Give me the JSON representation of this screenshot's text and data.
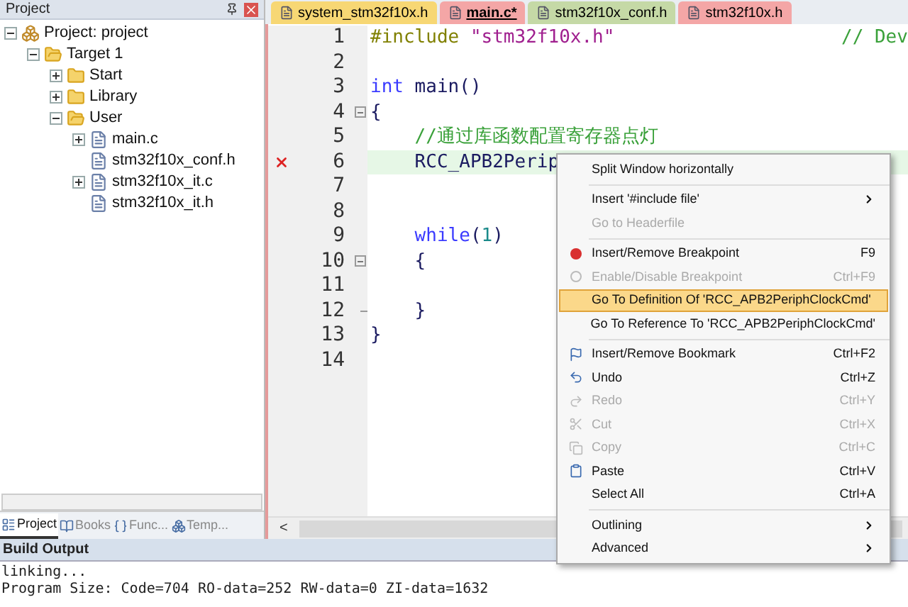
{
  "project_panel": {
    "title": "Project",
    "tree": [
      {
        "label": "Project: project",
        "kind": "project",
        "expanded": true,
        "children": [
          {
            "label": "Target 1",
            "kind": "target",
            "expanded": true,
            "children": [
              {
                "label": "Start",
                "kind": "folder",
                "expanded": false
              },
              {
                "label": "Library",
                "kind": "folder",
                "expanded": false
              },
              {
                "label": "User",
                "kind": "folder",
                "expanded": true,
                "children": [
                  {
                    "label": "main.c",
                    "kind": "file",
                    "expanded": false
                  },
                  {
                    "label": "stm32f10x_conf.h",
                    "kind": "file"
                  },
                  {
                    "label": "stm32f10x_it.c",
                    "kind": "file",
                    "expanded": false
                  },
                  {
                    "label": "stm32f10x_it.h",
                    "kind": "file"
                  }
                ]
              }
            ]
          }
        ]
      }
    ],
    "tabs": [
      {
        "label": "Project",
        "selected": true
      },
      {
        "label": "Books",
        "selected": false
      },
      {
        "label": "Func...",
        "selected": false
      },
      {
        "label": "Temp...",
        "selected": false
      }
    ]
  },
  "editor": {
    "tabs": [
      {
        "label": "system_stm32f10x.h",
        "color": "#f7d774",
        "selected": false
      },
      {
        "label": "main.c*",
        "color": "#f4a6a6",
        "selected": true
      },
      {
        "label": "stm32f10x_conf.h",
        "color": "#c5d9a6",
        "selected": false
      },
      {
        "label": "stm32f10x.h",
        "color": "#f4a6a6",
        "selected": false
      }
    ],
    "lines": [
      {
        "number": "1",
        "error": false,
        "highlighted": false,
        "fold_start": false,
        "fold_end": false,
        "segments": [
          {
            "text": "#include",
            "kind": "preproc"
          },
          {
            "text": " \"stm32f10x.h\"",
            "kind": "string"
          }
        ],
        "aside": "// Dev"
      },
      {
        "number": "2",
        "error": false,
        "highlighted": false,
        "fold_start": false,
        "fold_end": false
      },
      {
        "number": "3",
        "error": false,
        "highlighted": false,
        "fold_start": false,
        "fold_end": false,
        "segments": [
          {
            "text": "int",
            "kind": "keyword"
          },
          {
            "text": " main()",
            "kind": "plain"
          }
        ]
      },
      {
        "number": "4",
        "error": false,
        "highlighted": false,
        "fold_start": true,
        "fold_end": false,
        "segments": [
          {
            "text": "{",
            "kind": "plain"
          }
        ]
      },
      {
        "number": "5",
        "error": false,
        "highlighted": false,
        "fold_start": false,
        "fold_end": false,
        "segments": [
          {
            "text": "    //通过库函数配置寄存器点灯",
            "kind": "comment"
          }
        ]
      },
      {
        "number": "6",
        "error": true,
        "highlighted": true,
        "fold_start": false,
        "fold_end": false,
        "segments": [
          {
            "text": "    RCC_APB2Perip",
            "kind": "plain"
          }
        ]
      },
      {
        "number": "7",
        "error": false,
        "highlighted": false,
        "fold_start": false,
        "fold_end": false
      },
      {
        "number": "8",
        "error": false,
        "highlighted": false,
        "fold_start": false,
        "fold_end": false
      },
      {
        "number": "9",
        "error": false,
        "highlighted": false,
        "fold_start": false,
        "fold_end": false,
        "segments": [
          {
            "text": "    while",
            "kind": "keyword"
          },
          {
            "text": "(",
            "kind": "plain"
          },
          {
            "text": "1",
            "kind": "number"
          },
          {
            "text": ")",
            "kind": "plain"
          }
        ]
      },
      {
        "number": "10",
        "error": false,
        "highlighted": false,
        "fold_start": true,
        "fold_end": false,
        "segments": [
          {
            "text": "    {",
            "kind": "plain"
          }
        ]
      },
      {
        "number": "11",
        "error": false,
        "highlighted": false,
        "fold_start": false,
        "fold_end": false
      },
      {
        "number": "12",
        "error": false,
        "highlighted": false,
        "fold_start": false,
        "fold_end": true,
        "segments": [
          {
            "text": "    }",
            "kind": "plain"
          }
        ]
      },
      {
        "number": "13",
        "error": false,
        "highlighted": false,
        "fold_start": false,
        "fold_end": false,
        "segments": [
          {
            "text": "}",
            "kind": "plain"
          }
        ]
      },
      {
        "number": "14",
        "error": false,
        "highlighted": false,
        "fold_start": false,
        "fold_end": false
      }
    ],
    "scroll_left": "<"
  },
  "context_menu": [
    {
      "kind": "plain",
      "label": "Split Window horizontally",
      "disabled": false,
      "selected": false
    },
    {
      "kind": "separator"
    },
    {
      "kind": "submenu",
      "label": "Insert '#include file'",
      "disabled": false,
      "selected": false
    },
    {
      "kind": "plain",
      "label": "Go to Headerfile",
      "disabled": true,
      "selected": false
    },
    {
      "kind": "separator"
    },
    {
      "kind": "breakpoint",
      "label": "Insert/Remove Breakpoint",
      "shortcut": "F9",
      "disabled": false,
      "selected": false
    },
    {
      "kind": "toggle",
      "label": "Enable/Disable Breakpoint",
      "shortcut": "Ctrl+F9",
      "disabled": true,
      "selected": false
    },
    {
      "kind": "plain",
      "label": "Go To Definition Of 'RCC_APB2PeriphClockCmd'",
      "disabled": false,
      "selected": true
    },
    {
      "kind": "plain",
      "label": "Go To Reference To 'RCC_APB2PeriphClockCmd'",
      "disabled": false,
      "selected": false
    },
    {
      "kind": "separator"
    },
    {
      "kind": "bookmark",
      "label": "Insert/Remove Bookmark",
      "shortcut": "Ctrl+F2",
      "disabled": false,
      "selected": false
    },
    {
      "kind": "undo",
      "label": "Undo",
      "shortcut": "Ctrl+Z",
      "disabled": false,
      "selected": false
    },
    {
      "kind": "redo",
      "label": "Redo",
      "shortcut": "Ctrl+Y",
      "disabled": true,
      "selected": false
    },
    {
      "kind": "cut",
      "label": "Cut",
      "shortcut": "Ctrl+X",
      "disabled": true,
      "selected": false
    },
    {
      "kind": "copy",
      "label": "Copy",
      "shortcut": "Ctrl+C",
      "disabled": true,
      "selected": false
    },
    {
      "kind": "paste",
      "label": "Paste",
      "shortcut": "Ctrl+V",
      "disabled": false,
      "selected": false
    },
    {
      "kind": "plain",
      "label": "Select All",
      "shortcut": "Ctrl+A",
      "disabled": false,
      "selected": false
    },
    {
      "kind": "separator"
    },
    {
      "kind": "submenu",
      "label": "Outlining",
      "disabled": false,
      "selected": false
    },
    {
      "kind": "submenu",
      "label": "Advanced",
      "disabled": false,
      "selected": false
    }
  ],
  "build_output": {
    "title": "Build Output",
    "lines": [
      "linking...",
      "Program Size: Code=704 RO-data=252 RW-data=0 ZI-data=1632"
    ]
  }
}
